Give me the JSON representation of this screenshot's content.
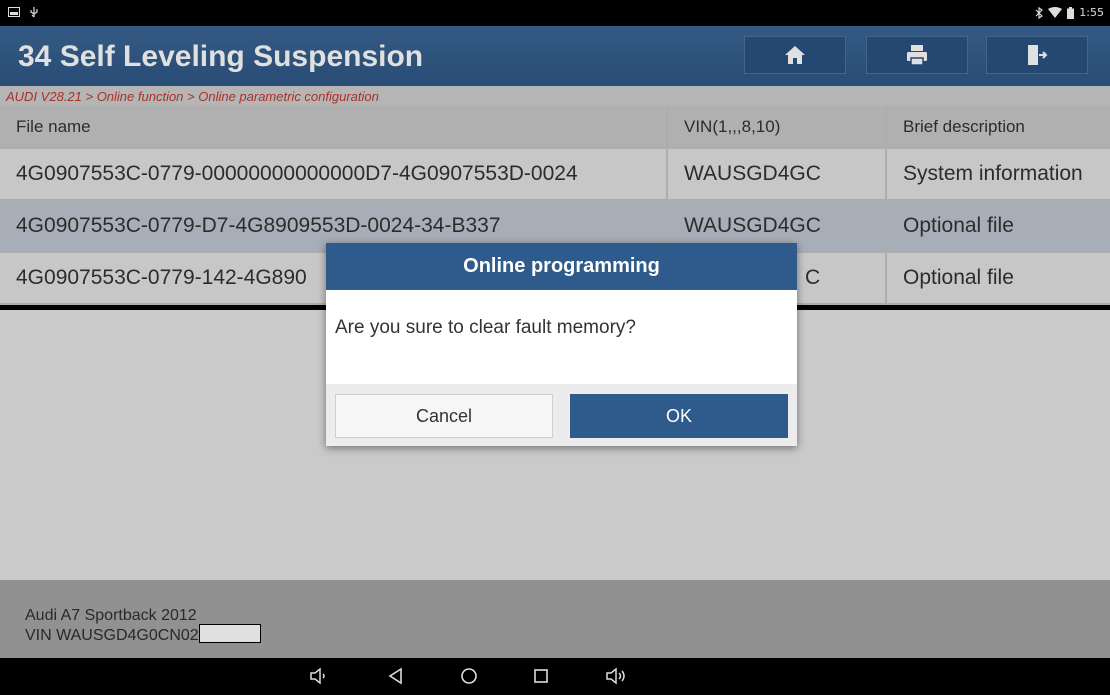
{
  "status_bar": {
    "left_icons": [
      "screenshot-icon",
      "usb-icon"
    ],
    "right_icons": [
      "bluetooth-icon",
      "wifi-icon",
      "battery-icon"
    ],
    "time": "1:55"
  },
  "header": {
    "title": "34 Self Leveling Suspension",
    "buttons": [
      "home-icon",
      "print-icon",
      "exit-icon"
    ]
  },
  "breadcrumb": "AUDI V28.21 > Online function > Online parametric configuration",
  "table": {
    "columns": [
      "File name",
      "VIN(1,,,8,10)",
      "Brief description"
    ],
    "rows": [
      {
        "file": "4G0907553C-0779-00000000000000D7-4G0907553D-0024",
        "vin": "WAUSGD4GC",
        "desc": "System information"
      },
      {
        "file": "4G0907553C-0779-D7-4G8909553D-0024-34-B337",
        "vin": "WAUSGD4GC",
        "desc": "Optional file"
      },
      {
        "file": "4G0907553C-0779-142-4G890",
        "vin": "C",
        "desc": "Optional file"
      }
    ]
  },
  "footer": {
    "car": "Audi A7 Sportback 2012",
    "vin": "VIN WAUSGD4G0CN02"
  },
  "dialog": {
    "title": "Online programming",
    "message": "Are you sure to clear fault memory?",
    "cancel_label": "Cancel",
    "ok_label": "OK"
  },
  "nav_bar": [
    "volume-down-icon",
    "back-icon",
    "home-circle-icon",
    "recents-icon",
    "volume-up-icon"
  ],
  "colors": {
    "header_bg": "#2f5b8c",
    "breadcrumb_text": "#c0392b",
    "selected_row": "#bfc7d2",
    "ok_button": "#2f5b8c"
  }
}
